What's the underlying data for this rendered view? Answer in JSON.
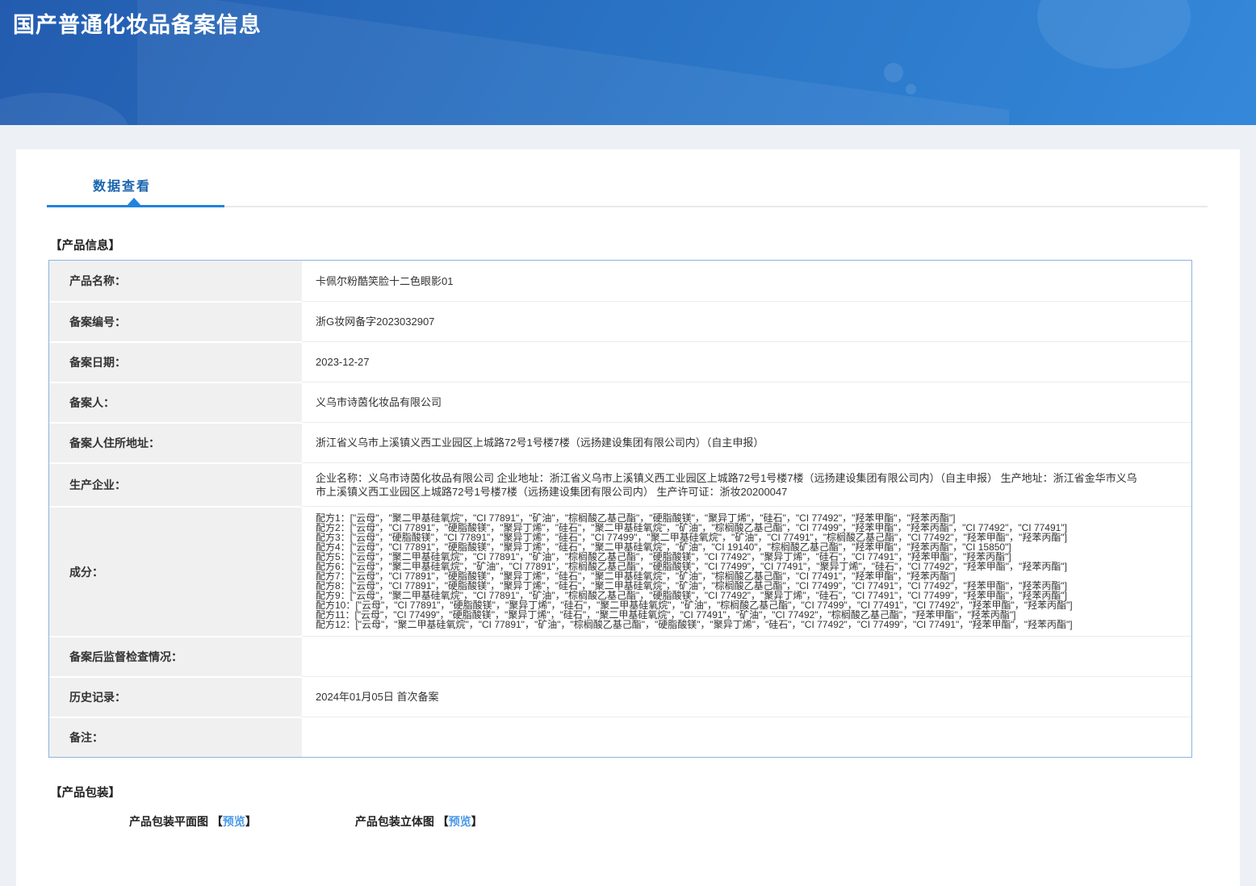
{
  "page": {
    "title": "国产普通化妆品备案信息"
  },
  "tab": {
    "label": "数据查看"
  },
  "section_product_info": {
    "title": "【产品信息】"
  },
  "table": {
    "rows": [
      {
        "label": "产品名称：",
        "value": "卡佩尔粉酷笑脸十二色眼影01"
      },
      {
        "label": "备案编号：",
        "value": "浙G妆网备字2023032907"
      },
      {
        "label": "备案日期：",
        "value": "2023-12-27"
      },
      {
        "label": "备案人：",
        "value": "义乌市诗茵化妆品有限公司"
      },
      {
        "label": "备案人住所地址：",
        "value": "浙江省义乌市上溪镇义西工业园区上城路72号1号楼7楼（远扬建设集团有限公司内）（自主申报）"
      },
      {
        "label": "生产企业：",
        "value": "企业名称：义乌市诗茵化妆品有限公司 企业地址：浙江省义乌市上溪镇义西工业园区上城路72号1号楼7楼（远扬建设集团有限公司内）（自主申报） 生产地址：浙江省金华市义乌市上溪镇义西工业园区上城路72号1号楼7楼（远扬建设集团有限公司内） 生产许可证：浙妆20200047"
      },
      {
        "label": "成分：",
        "value": [
          "配方1：[\"云母\"，\"聚二甲基硅氧烷\"，\"CI 77891\"，\"矿油\"，\"棕榈酸乙基己酯\"，\"硬脂酸镁\"，\"聚异丁烯\"，\"硅石\"，\"CI 77492\"，\"羟苯甲酯\"，\"羟苯丙酯\"]",
          "配方2：[\"云母\"，\"CI 77891\"，\"硬脂酸镁\"，\"聚异丁烯\"，\"硅石\"，\"聚二甲基硅氧烷\"，\"矿油\"，\"棕榈酸乙基己酯\"，\"CI 77499\"，\"羟苯甲酯\"，\"羟苯丙酯\"，\"CI 77492\"，\"CI 77491\"]",
          "配方3：[\"云母\"，\"硬脂酸镁\"，\"CI 77891\"，\"聚异丁烯\"，\"硅石\"，\"CI 77499\"，\"聚二甲基硅氧烷\"，\"矿油\"，\"CI 77491\"，\"棕榈酸乙基己酯\"，\"CI 77492\"，\"羟苯甲酯\"，\"羟苯丙酯\"]",
          "配方4：[\"云母\"，\"CI 77891\"，\"硬脂酸镁\"，\"聚异丁烯\"，\"硅石\"，\"聚二甲基硅氧烷\"，\"矿油\"，\"CI 19140\"，\"棕榈酸乙基己酯\"，\"羟苯甲酯\"，\"羟苯丙酯\"，\"CI 15850\"]",
          "配方5：[\"云母\"，\"聚二甲基硅氧烷\"，\"CI 77891\"，\"矿油\"，\"棕榈酸乙基己酯\"，\"硬脂酸镁\"，\"CI 77492\"，\"聚异丁烯\"，\"硅石\"，\"CI 77491\"，\"羟苯甲酯\"，\"羟苯丙酯\"]",
          "配方6：[\"云母\"，\"聚二甲基硅氧烷\"，\"矿油\"，\"CI 77891\"，\"棕榈酸乙基己酯\"，\"硬脂酸镁\"，\"CI 77499\"，\"CI 77491\"，\"聚异丁烯\"，\"硅石\"，\"CI 77492\"，\"羟苯甲酯\"，\"羟苯丙酯\"]",
          "配方7：[\"云母\"，\"CI 77891\"，\"硬脂酸镁\"，\"聚异丁烯\"，\"硅石\"，\"聚二甲基硅氧烷\"，\"矿油\"，\"棕榈酸乙基己酯\"，\"CI 77491\"，\"羟苯甲酯\"，\"羟苯丙酯\"]",
          "配方8：[\"云母\"，\"CI 77891\"，\"硬脂酸镁\"，\"聚异丁烯\"，\"硅石\"，\"聚二甲基硅氧烷\"，\"矿油\"，\"棕榈酸乙基己酯\"，\"CI 77499\"，\"CI 77491\"，\"CI 77492\"，\"羟苯甲酯\"，\"羟苯丙酯\"]",
          "配方9：[\"云母\"，\"聚二甲基硅氧烷\"，\"CI 77891\"，\"矿油\"，\"棕榈酸乙基己酯\"，\"硬脂酸镁\"，\"CI 77492\"，\"聚异丁烯\"，\"硅石\"，\"CI 77491\"，\"CI 77499\"，\"羟苯甲酯\"，\"羟苯丙酯\"]",
          "配方10：[\"云母\"，\"CI 77891\"，\"硬脂酸镁\"，\"聚异丁烯\"，\"硅石\"，\"聚二甲基硅氧烷\"，\"矿油\"，\"棕榈酸乙基己酯\"，\"CI 77499\"，\"CI 77491\"，\"CI 77492\"，\"羟苯甲酯\"，\"羟苯丙酯\"]",
          "配方11：[\"云母\"，\"CI 77499\"，\"硬脂酸镁\"，\"聚异丁烯\"，\"硅石\"，\"聚二甲基硅氧烷\"，\"CI 77491\"，\"矿油\"，\"CI 77492\"，\"棕榈酸乙基己酯\"，\"羟苯甲酯\"，\"羟苯丙酯\"]",
          "配方12：[\"云母\"，\"聚二甲基硅氧烷\"，\"CI 77891\"，\"矿油\"，\"棕榈酸乙基己酯\"，\"硬脂酸镁\"，\"聚异丁烯\"，\"硅石\"，\"CI 77492\"，\"CI 77499\"，\"CI 77491\"，\"羟苯甲酯\"，\"羟苯丙酯\"]"
        ]
      },
      {
        "label": "备案后监督检查情况：",
        "value": ""
      },
      {
        "label": "历史记录：",
        "value": "2024年01月05日 首次备案"
      },
      {
        "label": "备注：",
        "value": ""
      }
    ]
  },
  "section_packaging": {
    "title": "【产品包装】",
    "items": [
      {
        "label": "产品包装平面图",
        "bracket_open": "【",
        "link_label": "预览",
        "bracket_close": "】"
      },
      {
        "label": "产品包装立体图",
        "bracket_open": "【",
        "link_label": "预览",
        "bracket_close": "】"
      }
    ]
  },
  "colors": {
    "banner_blue_dark": "#235caf",
    "banner_blue_light": "#3488da",
    "tab_text": "#1a65b0",
    "tab_underline": "#1f83e0",
    "table_border": "#8db4de",
    "label_cell_bg": "#f0f0f0",
    "link_blue": "#4a9ae8",
    "page_bg": "#edf1f6"
  }
}
